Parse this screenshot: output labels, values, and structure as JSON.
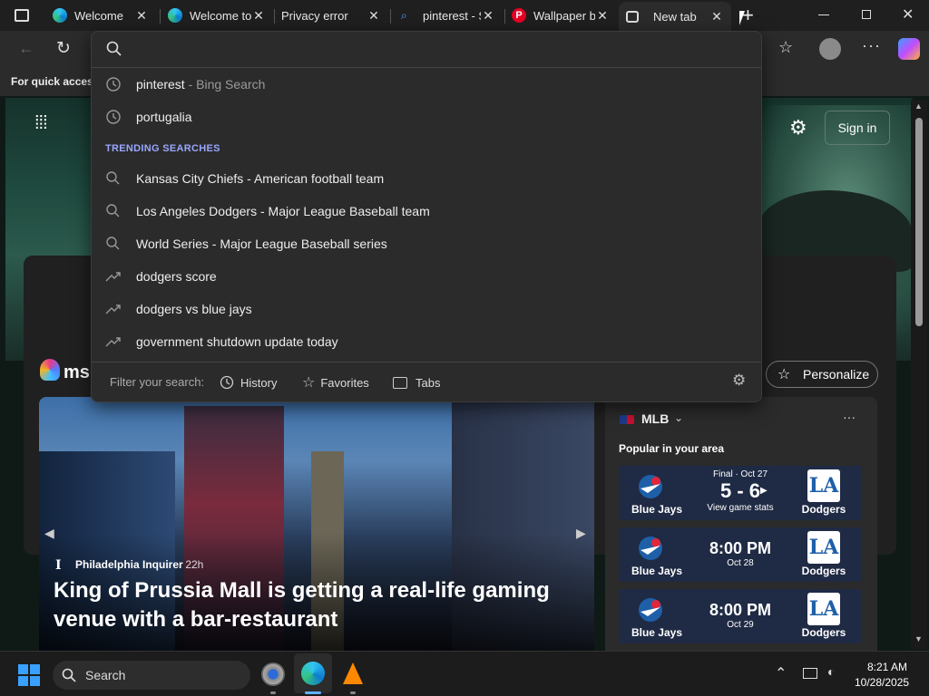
{
  "tabs": [
    {
      "label": "Welcome",
      "icon": "edge-icon",
      "active": false
    },
    {
      "label": "Welcome to",
      "icon": "edge-icon",
      "active": false
    },
    {
      "label": "Privacy error",
      "icon": "none",
      "active": false
    },
    {
      "label": "pinterest - S",
      "icon": "search-icon",
      "active": false
    },
    {
      "label": "Wallpaper b",
      "icon": "pinterest-icon",
      "active": false
    },
    {
      "label": "New tab",
      "icon": "new-tab-icon",
      "active": true
    }
  ],
  "favorites_bar": {
    "label": "For quick access"
  },
  "search": {
    "value": "",
    "placeholder": ""
  },
  "history_suggestions": [
    {
      "text": "pinterest",
      "sub": " - Bing Search"
    },
    {
      "text": "portugalia",
      "sub": ""
    }
  ],
  "trending_header": "TRENDING SEARCHES",
  "trending_suggestions": [
    {
      "text": "Kansas City Chiefs",
      "sub": " - American football team",
      "icon": "search-icon"
    },
    {
      "text": "Los Angeles Dodgers",
      "sub": " - Major League Baseball team",
      "icon": "search-icon"
    },
    {
      "text": "World Series",
      "sub": " - Major League Baseball series",
      "icon": "search-icon"
    },
    {
      "text": "dodgers score",
      "sub": "",
      "icon": "trending-icon"
    },
    {
      "text": "dodgers vs blue jays",
      "sub": "",
      "icon": "trending-icon"
    },
    {
      "text": "government shutdown update today",
      "sub": "",
      "icon": "trending-icon"
    }
  ],
  "filter": {
    "label": "Filter your search:",
    "history": "History",
    "favorites": "Favorites",
    "tabs": "Tabs"
  },
  "msn": {
    "logo_text": "msn",
    "signin": "Sign in",
    "personalize": "Personalize"
  },
  "news": {
    "source": "Philadelphia Inquirer",
    "age": "· 22h",
    "headline": "King of Prussia Mall is getting a real-life gaming venue with a bar-restaurant"
  },
  "mlb": {
    "title": "MLB",
    "subtitle": "Popular in your area",
    "games": [
      {
        "home": "Blue Jays",
        "away": "Dodgers",
        "status": "Final · Oct 27",
        "score": "5 - 6",
        "note": "View game stats"
      },
      {
        "home": "Blue Jays",
        "away": "Dodgers",
        "status": "",
        "score": "8:00 PM",
        "note": "Oct 28"
      },
      {
        "home": "Blue Jays",
        "away": "Dodgers",
        "status": "",
        "score": "8:00 PM",
        "note": "Oct 29"
      }
    ]
  },
  "taskbar": {
    "search_label": "Search",
    "time": "8:21 AM",
    "date": "10/28/2025"
  },
  "colors": {
    "accent": "#9aa6ff",
    "jays_blue": "#1e5fa8"
  }
}
